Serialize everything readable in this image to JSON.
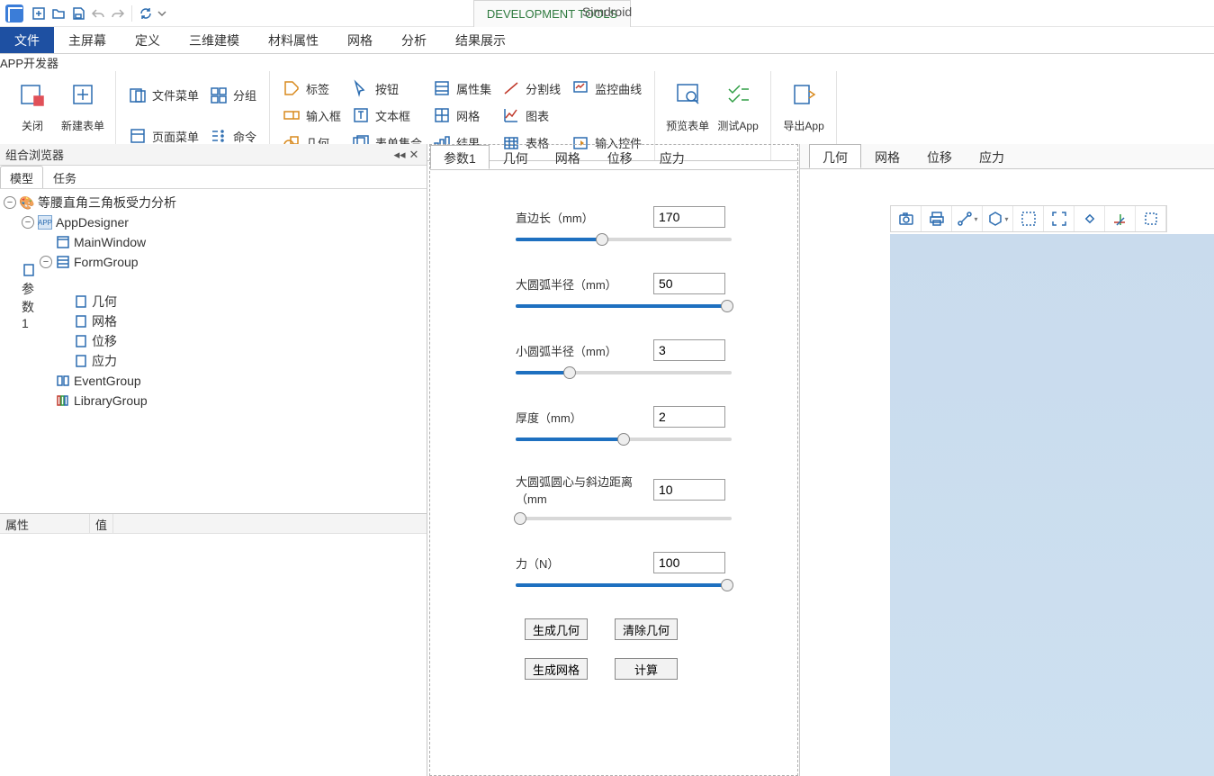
{
  "app_name": "Simdroid",
  "dev_tools_label": "DEVELOPMENT TOOLS",
  "quick_access": [
    "new",
    "open",
    "save",
    "undo",
    "redo",
    "refresh"
  ],
  "main_tabs": {
    "items": [
      "文件",
      "主屏幕",
      "定义",
      "三维建模",
      "材料属性",
      "网格",
      "分析",
      "结果展示"
    ],
    "active": "文件",
    "app_tab": "APP开发器"
  },
  "ribbon": {
    "g1": {
      "close": "关闭",
      "newform": "新建表单"
    },
    "g2": {
      "filemenu": "文件菜单",
      "pagemenu": "页面菜单",
      "group": "分组",
      "command": "命令"
    },
    "g3": {
      "label": "标签",
      "button": "按钮",
      "propset": "属性集",
      "splitline": "分割线",
      "monitor": "监控曲线",
      "input": "输入框",
      "textbox": "文本框",
      "grid": "网格",
      "chart": "图表",
      "geom": "几何",
      "formset": "表单集合",
      "result": "结果",
      "table": "表格",
      "inputctrl": "输入控件"
    },
    "g4": {
      "preview": "预览表单",
      "test": "测试App"
    },
    "g5": {
      "export": "导出App"
    }
  },
  "left": {
    "title": "组合浏览器",
    "tabs": {
      "model": "模型",
      "tasks": "任务"
    },
    "tree": {
      "root": "等腰直角三角板受力分析",
      "appdesigner": "AppDesigner",
      "mainwindow": "MainWindow",
      "formgroup": "FormGroup",
      "forms": [
        "参数1",
        "几何",
        "网格",
        "位移",
        "应力"
      ],
      "eventgroup": "EventGroup",
      "librarygroup": "LibraryGroup"
    },
    "prop": {
      "attr": "属性",
      "value": "值"
    }
  },
  "center": {
    "tabs": [
      "参数1",
      "几何",
      "网格",
      "位移",
      "应力"
    ],
    "active": 0,
    "fields": [
      {
        "label": "直边长（mm）",
        "value": "170",
        "pct": 40
      },
      {
        "label": "大圆弧半径（mm）",
        "value": "50",
        "pct": 98
      },
      {
        "label": "小圆弧半径（mm）",
        "value": "3",
        "pct": 25
      },
      {
        "label": "厚度（mm）",
        "value": "2",
        "pct": 50
      },
      {
        "label": "大圆弧圆心与斜边距离（mm",
        "value": "10",
        "pct": 2
      },
      {
        "label": "力（N）",
        "value": "100",
        "pct": 98
      }
    ],
    "buttons1": {
      "gen_geom": "生成几何",
      "clear_geom": "清除几何"
    },
    "buttons2": {
      "gen_mesh": "生成网格",
      "compute": "计算"
    }
  },
  "right": {
    "tabs": [
      "几何",
      "网格",
      "位移",
      "应力"
    ],
    "active": 0,
    "toolbar": [
      "camera",
      "print",
      "measure",
      "hexagon",
      "zoom-window",
      "fit",
      "rotate-view",
      "axes",
      "more"
    ]
  }
}
